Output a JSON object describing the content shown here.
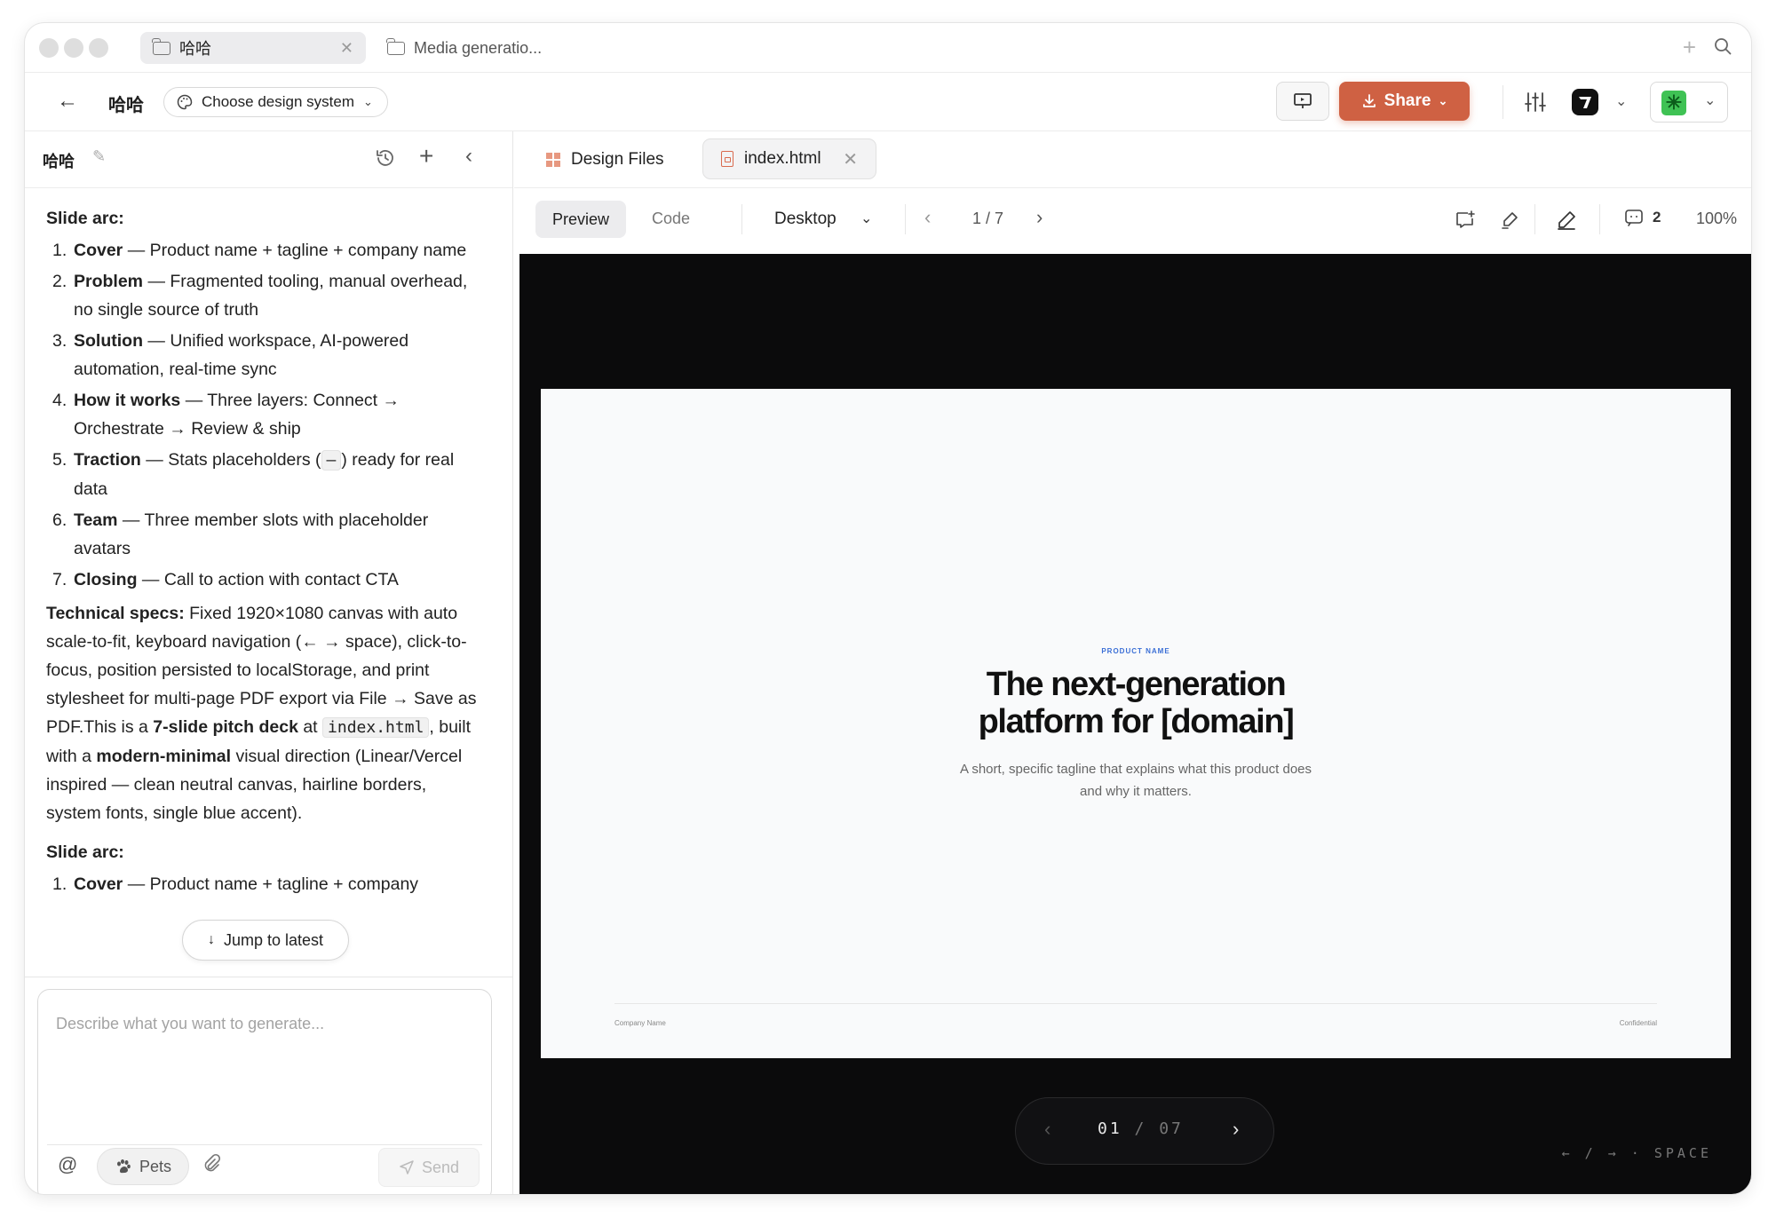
{
  "titlebar": {
    "tabs": [
      {
        "label": "哈哈"
      },
      {
        "label": "Media generatio..."
      }
    ]
  },
  "toolbar": {
    "project_name": "哈哈",
    "design_system_label": "Choose design system",
    "share_label": "Share"
  },
  "left_panel": {
    "title": "哈哈",
    "message": {
      "slide_arc_heading": "Slide arc:",
      "slide_arc": [
        {
          "num": "1.",
          "title": "Cover",
          "text": " — Product name + tagline + company name"
        },
        {
          "num": "2.",
          "title": "Problem",
          "text": " — Fragmented tooling, manual overhead, no single source of truth"
        },
        {
          "num": "3.",
          "title": "Solution",
          "text": " — Unified workspace, AI-powered automation, real-time sync"
        },
        {
          "num": "4.",
          "title": "How it works",
          "text": " — Three layers: Connect → Orchestrate → Review & ship"
        },
        {
          "num": "5.",
          "title": "Traction",
          "text_before": " — Stats placeholders (",
          "code": "—",
          "text_after": ") ready for real data"
        },
        {
          "num": "6.",
          "title": "Team",
          "text": " — Three member slots with placeholder avatars"
        },
        {
          "num": "7.",
          "title": "Closing",
          "text": " — Call to action with contact CTA"
        }
      ],
      "specs_label": "Technical specs:",
      "specs_text": " Fixed 1920×1080 canvas with auto scale-to-fit, keyboard navigation (← → space), click-to-focus, position persisted to localStorage, and print stylesheet for multi-page PDF export via File → Save as PDF.This is a ",
      "deck_bold": "7-slide pitch deck",
      "at_text": " at ",
      "file_code": "index.html",
      "built_text": ", built with a ",
      "style_bold": "modern-minimal",
      "visual_text": " visual direction (Linear/Vercel inspired — clean neutral canvas, hairline borders, system fonts, single blue accent).",
      "slide_arc_heading_2": "Slide arc:",
      "partial_item": {
        "num": "1.",
        "title": "Cover",
        "text": " — Product name + tagline + company"
      }
    },
    "jump_label": "Jump to latest",
    "composer": {
      "placeholder": "Describe what you want to generate...",
      "at_symbol": "@",
      "pets_label": "Pets",
      "send_label": "Send"
    }
  },
  "right_panel": {
    "tabs": [
      {
        "label": "Design Files"
      },
      {
        "label": "index.html"
      }
    ],
    "view_bar": {
      "preview_label": "Preview",
      "code_label": "Code",
      "device": "Desktop",
      "page_indicator": "1 / 7",
      "comment_count": "2",
      "zoom": "100%"
    },
    "slide": {
      "eyebrow": "PRODUCT NAME",
      "headline_line1": "The next-generation",
      "headline_line2": "platform for [domain]",
      "tagline_line1": "A short, specific tagline that explains what this product does",
      "tagline_line2": "and why it matters.",
      "footer_left": "Company Name",
      "footer_right": "Confidential"
    },
    "pager": {
      "current": "01",
      "separator": "/",
      "total": "07"
    },
    "keyboard_hint": "← / → · SPACE"
  },
  "colors": {
    "accent": "#cf6143",
    "slide_accent": "#3b6fd6",
    "stage_bg": "#0b0b0c",
    "avatar": "#3fc254"
  },
  "icons": [
    "folder-icon",
    "close-icon",
    "plus-icon",
    "search-icon",
    "back-arrow-icon",
    "palette-icon",
    "chevron-down-icon",
    "present-icon",
    "download-icon",
    "sliders-icon",
    "logo-icon",
    "avatar-icon",
    "pencil-icon",
    "history-icon",
    "chevron-left-icon",
    "arrow-down-icon",
    "at-icon",
    "paw-icon",
    "paperclip-icon",
    "send-icon",
    "grid-icon",
    "file-icon",
    "chevron-right-icon",
    "comment-add-icon",
    "brush-icon",
    "edit-icon",
    "comment-icon"
  ]
}
